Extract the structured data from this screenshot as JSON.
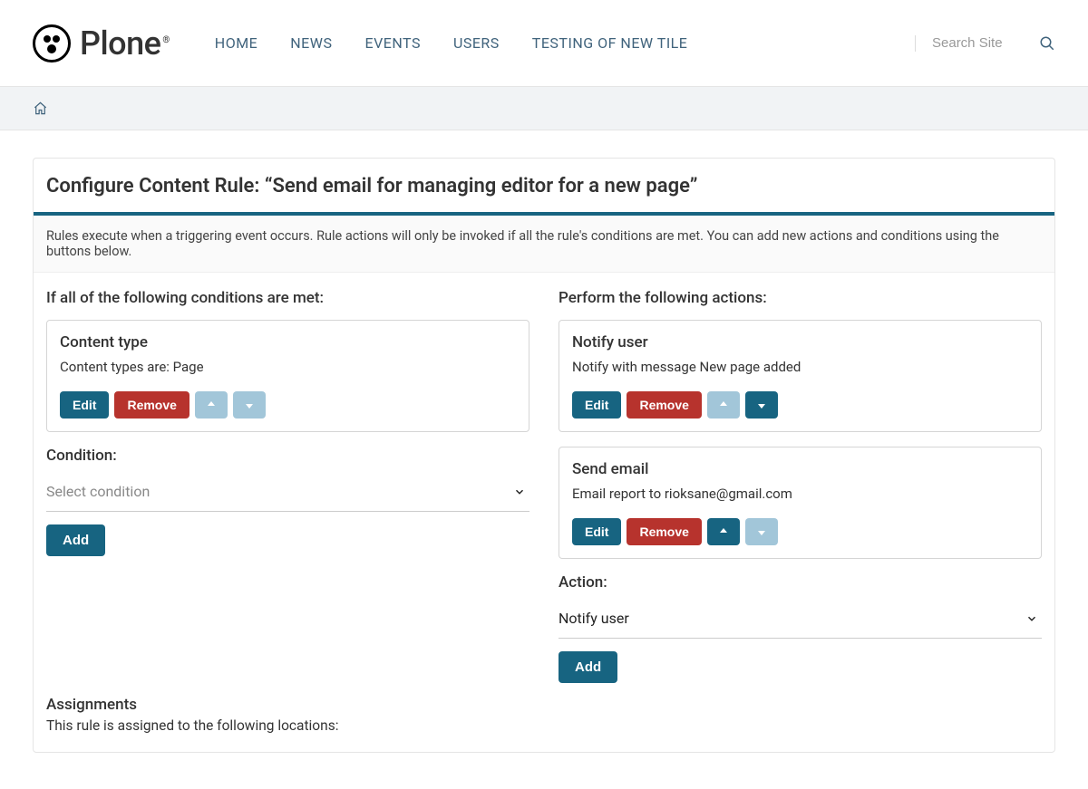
{
  "brand": "Plone",
  "nav": [
    "HOME",
    "NEWS",
    "EVENTS",
    "USERS",
    "TESTING OF NEW TILE"
  ],
  "search": {
    "placeholder": "Search Site"
  },
  "page": {
    "title": "Configure Content Rule: “Send email for managing editor for a new page”",
    "description": "Rules execute when a triggering event occurs. Rule actions will only be invoked if all the rule's conditions are met. You can add new actions and conditions using the buttons below."
  },
  "conditions": {
    "heading": "If all of the following conditions are met:",
    "items": [
      {
        "title": "Content type",
        "desc": "Content types are: Page"
      }
    ],
    "subheading": "Condition:",
    "select_placeholder": "Select condition"
  },
  "actions": {
    "heading": "Perform the following actions:",
    "items": [
      {
        "title": "Notify user",
        "desc": "Notify with message New page added"
      },
      {
        "title": "Send email",
        "desc": "Email report to rioksane@gmail.com"
      }
    ],
    "subheading": "Action:",
    "select_value": "Notify user"
  },
  "buttons": {
    "edit": "Edit",
    "remove": "Remove",
    "add": "Add"
  },
  "assignments": {
    "title": "Assignments",
    "desc": "This rule is assigned to the following locations:"
  }
}
